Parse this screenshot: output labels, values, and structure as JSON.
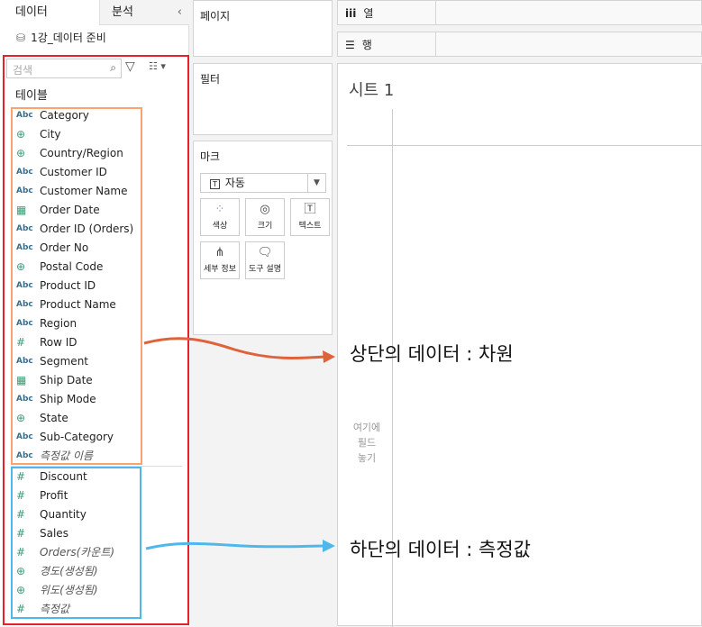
{
  "tabs": {
    "data": "데이터",
    "analysis": "분석"
  },
  "datasource": "1강_데이터 준비",
  "search": {
    "placeholder": "검색"
  },
  "tables_label": "테이블",
  "dimensions": [
    {
      "icon": "Abc",
      "name": "Category"
    },
    {
      "icon": "globe",
      "name": "City"
    },
    {
      "icon": "globe",
      "name": "Country/Region"
    },
    {
      "icon": "Abc",
      "name": "Customer ID"
    },
    {
      "icon": "Abc",
      "name": "Customer Name"
    },
    {
      "icon": "calendar",
      "name": "Order Date"
    },
    {
      "icon": "Abc",
      "name": "Order ID (Orders)"
    },
    {
      "icon": "Abc",
      "name": "Order No"
    },
    {
      "icon": "globe",
      "name": "Postal Code"
    },
    {
      "icon": "Abc",
      "name": "Product ID"
    },
    {
      "icon": "Abc",
      "name": "Product Name"
    },
    {
      "icon": "Abc",
      "name": "Region"
    },
    {
      "icon": "#",
      "name": "Row ID"
    },
    {
      "icon": "Abc",
      "name": "Segment"
    },
    {
      "icon": "calendar",
      "name": "Ship Date"
    },
    {
      "icon": "Abc",
      "name": "Ship Mode"
    },
    {
      "icon": "globe",
      "name": "State"
    },
    {
      "icon": "Abc",
      "name": "Sub-Category"
    },
    {
      "icon": "Abc",
      "name": "측정값 이름",
      "italic": true
    }
  ],
  "measures": [
    {
      "icon": "#",
      "name": "Discount"
    },
    {
      "icon": "#",
      "name": "Profit"
    },
    {
      "icon": "#",
      "name": "Quantity"
    },
    {
      "icon": "#",
      "name": "Sales"
    },
    {
      "icon": "#",
      "name": "Orders(카운트)",
      "italic": true
    },
    {
      "icon": "globe",
      "name": "경도(생성됨)",
      "italic": true
    },
    {
      "icon": "globe",
      "name": "위도(생성됨)",
      "italic": true
    },
    {
      "icon": "#",
      "name": "측정값",
      "italic": true
    }
  ],
  "cards": {
    "pages": "페이지",
    "filters": "필터",
    "marks": "마크"
  },
  "marks": {
    "type": "자동",
    "buttons": [
      "색상",
      "크기",
      "텍스트",
      "세부 정보",
      "도구 설명"
    ]
  },
  "shelves": {
    "columns": "열",
    "rows": "행"
  },
  "sheet": {
    "title": "시트 1",
    "drop_hint": [
      "여기에",
      "필드",
      "놓기"
    ]
  },
  "annotations": {
    "dimensions": "상단의 데이터 : 차원",
    "measures": "하단의 데이터 : 측정값"
  },
  "colors": {
    "red_box": "#e8202a",
    "orange_box": "#f8a46c",
    "blue_box": "#4fb8ea"
  }
}
